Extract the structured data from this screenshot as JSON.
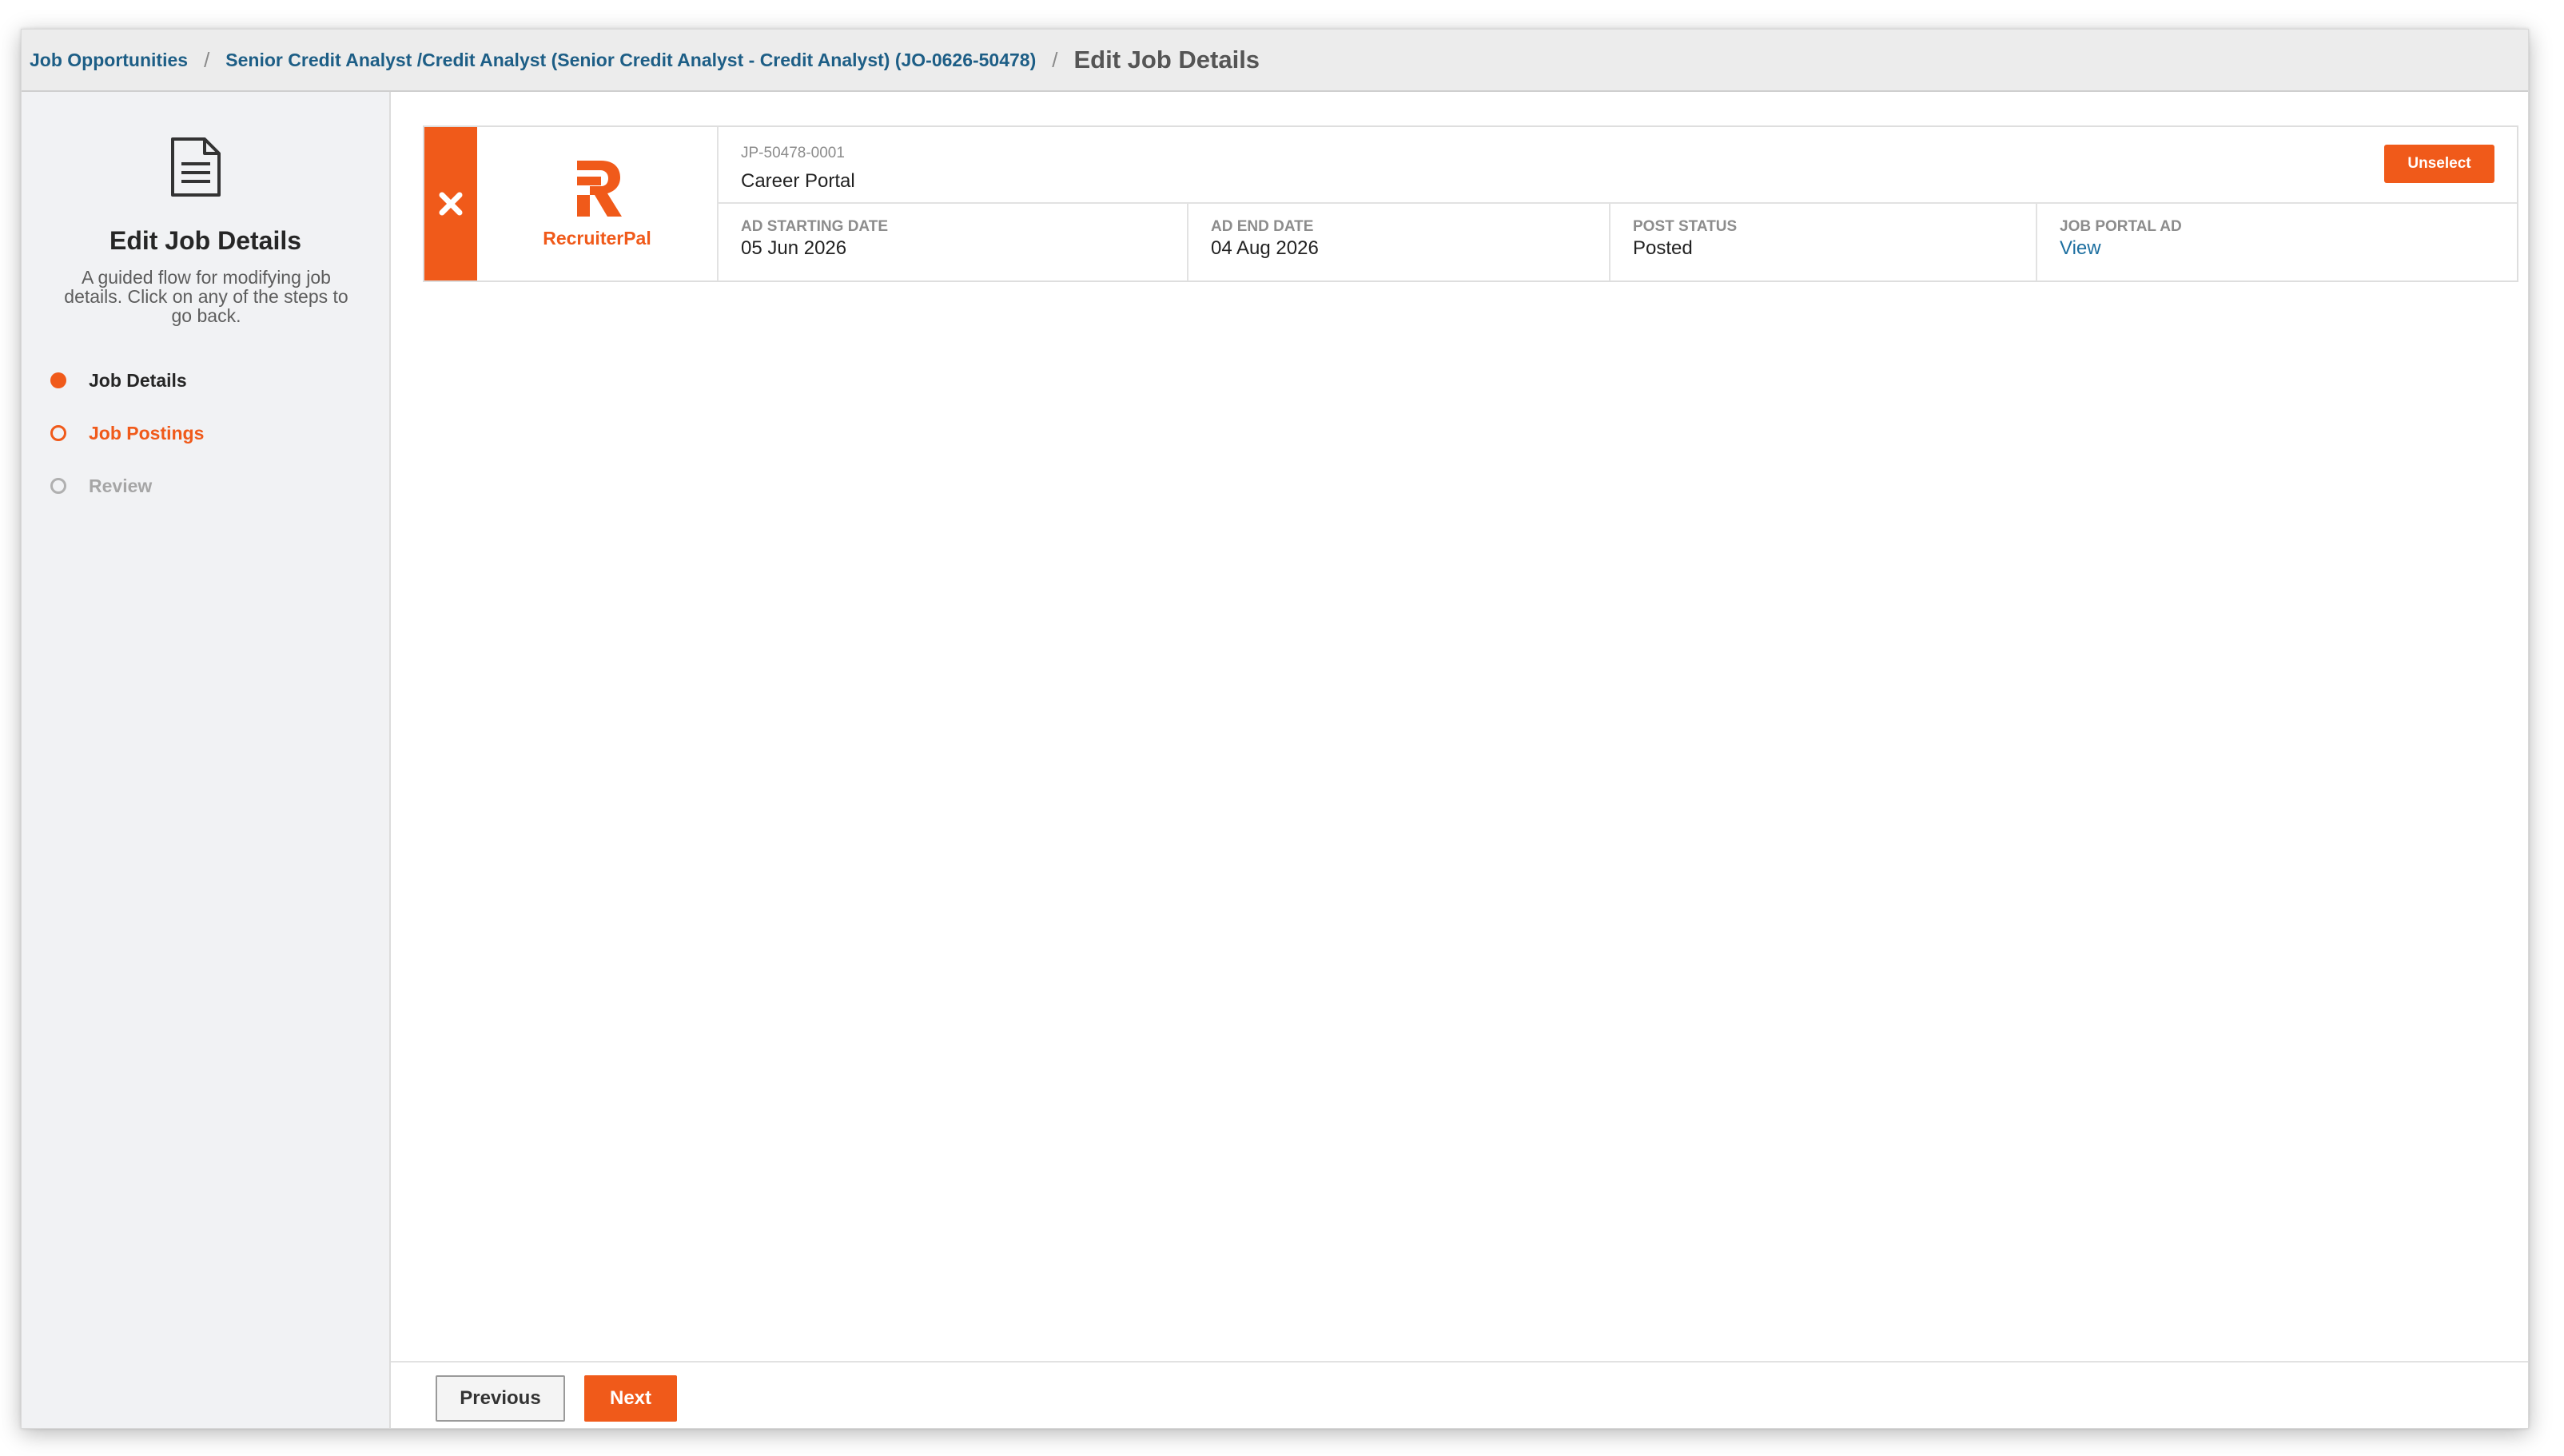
{
  "colors": {
    "accent": "#f05a1a",
    "link": "#1d5e86",
    "sidebar_bg": "#f1f2f4",
    "topbar_bg": "#ececec"
  },
  "breadcrumb": {
    "items": [
      "Job Opportunities",
      "Senior Credit Analyst /Credit Analyst (Senior Credit Analyst - Credit Analyst) (JO-0626-50478)"
    ],
    "separator": "/",
    "current": "Edit Job Details"
  },
  "sidebar": {
    "icon": "document-icon",
    "title": "Edit Job Details",
    "description": "A guided flow for modifying job details. Click on any of the steps to go back.",
    "steps": [
      {
        "label": "Job Details",
        "state": "completed"
      },
      {
        "label": "Job Postings",
        "state": "current"
      },
      {
        "label": "Review",
        "state": "pending"
      }
    ]
  },
  "posting": {
    "remove_icon": "close-icon",
    "logo_text": "RecruiterPal",
    "id": "JP-50478-0001",
    "name": "Career Portal",
    "unselect_label": "Unselect",
    "fields": [
      {
        "label": "AD STARTING DATE",
        "value": "05 Jun 2026"
      },
      {
        "label": "AD END DATE",
        "value": "04 Aug 2026"
      },
      {
        "label": "POST STATUS",
        "value": "Posted"
      },
      {
        "label": "JOB PORTAL AD",
        "value": "View"
      }
    ]
  },
  "footer": {
    "previous_label": "Previous",
    "next_label": "Next"
  }
}
